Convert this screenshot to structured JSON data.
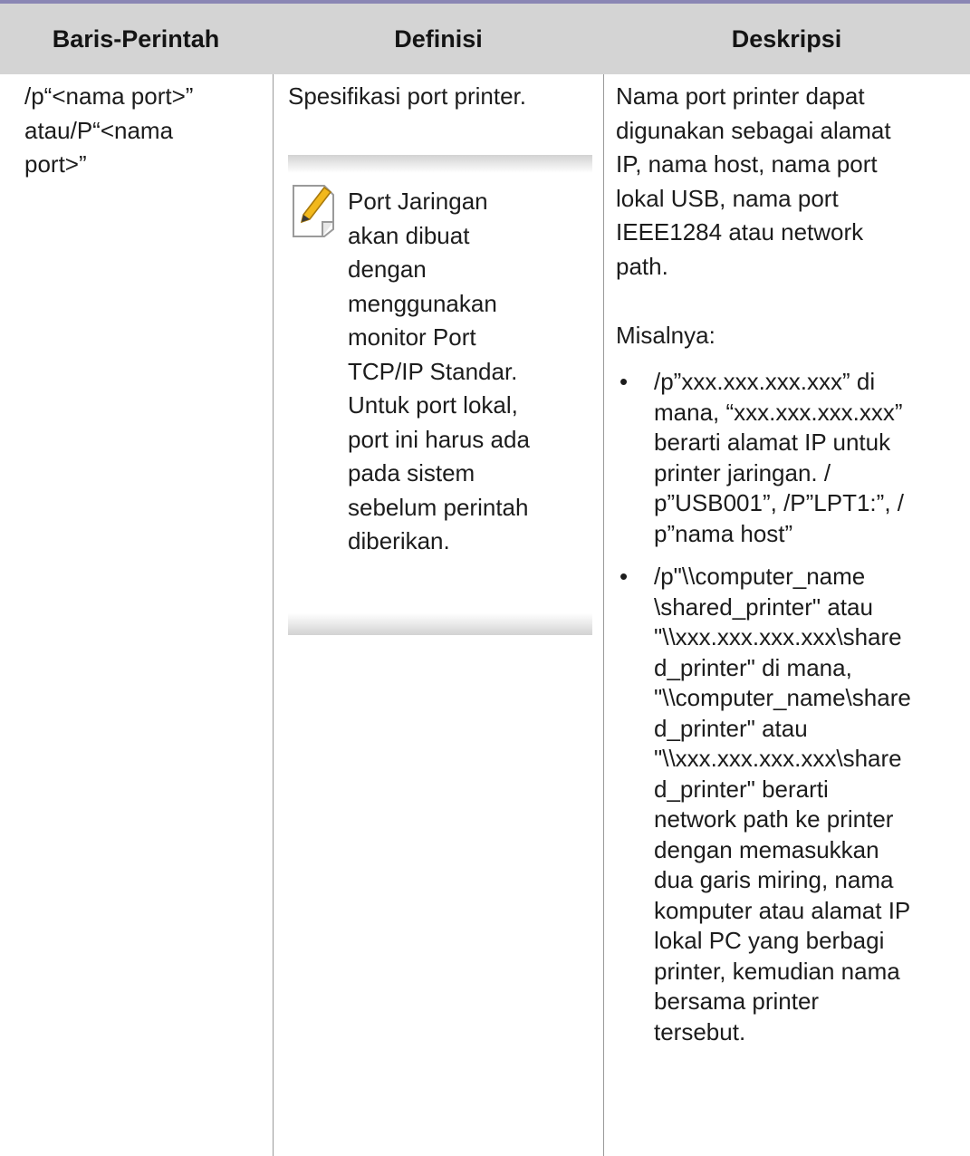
{
  "table": {
    "headers": [
      "Baris-Perintah",
      "Definisi",
      "Deskripsi"
    ],
    "row": {
      "command_lines": [
        "/p“<nama port>”",
        "atau/P“<nama",
        "port>”"
      ],
      "definition": "Spesifikasi port printer.",
      "note": {
        "icon": "note-pencil-icon",
        "lines": [
          "Port Jaringan",
          "akan dibuat",
          "dengan",
          "menggunakan",
          "monitor Port",
          "TCP/IP Standar.",
          "Untuk port lokal,",
          "port ini harus ada",
          "pada sistem",
          "sebelum perintah",
          "diberikan."
        ]
      },
      "description_lines": [
        "Nama port printer dapat",
        "digunakan sebagai alamat",
        "IP, nama host, nama port",
        "lokal USB, nama port",
        "IEEE1284 atau network",
        "path."
      ],
      "example_label": "Misalnya:",
      "bullet_symbol": "•",
      "bullets": [
        [
          "/p”xxx.xxx.xxx.xxx” di",
          "mana, “xxx.xxx.xxx.xxx”",
          "berarti alamat IP untuk",
          "printer jaringan. /",
          "p”USB001”, /P”LPT1:”, /",
          "p”nama host”"
        ],
        [
          "/p\"\\\\computer_name",
          "\\shared_printer\" atau",
          "\"\\\\xxx.xxx.xxx.xxx\\share",
          "d_printer\" di mana,",
          "\"\\\\computer_name\\share",
          "d_printer\" atau",
          "\"\\\\xxx.xxx.xxx.xxx\\share",
          "d_printer\" berarti",
          "network path ke printer",
          "dengan memasukkan",
          "dua garis miring, nama",
          "komputer atau alamat IP",
          "lokal PC yang berbagi",
          "printer, kemudian nama",
          "bersama printer",
          "tersebut."
        ]
      ]
    }
  },
  "colors": {
    "top_rule": "#8a86b4",
    "header_bg": "#d4d4d4",
    "divider": "#9a9a9a",
    "pencil": "#f2b81c"
  }
}
